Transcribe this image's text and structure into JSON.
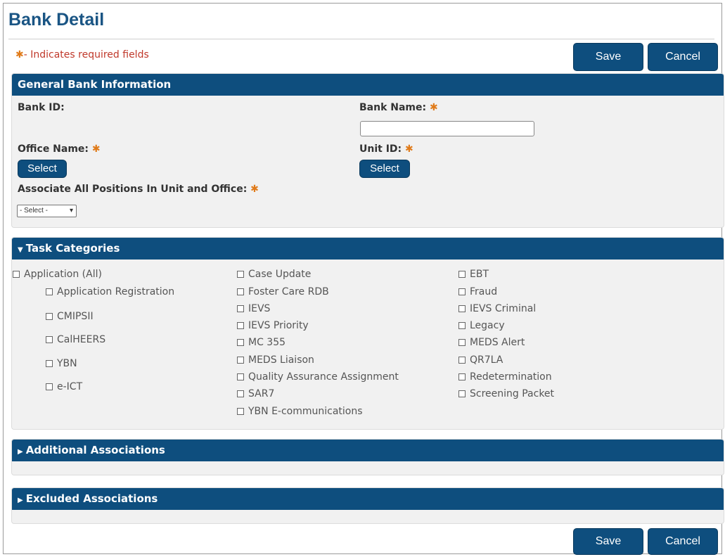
{
  "page": {
    "title": "Bank Detail"
  },
  "required_note": {
    "star": "✱",
    "text": "- Indicates required fields"
  },
  "buttons": {
    "save": "Save",
    "cancel": "Cancel"
  },
  "general": {
    "header": "General Bank Information",
    "bank_id_label": "Bank ID:",
    "bank_name_label": "Bank Name:",
    "bank_name_value": "",
    "office_name_label": "Office Name:",
    "unit_id_label": "Unit ID:",
    "select_label": "Select",
    "associate_label": "Associate All Positions In Unit and Office:",
    "associate_selected": "- Select -"
  },
  "tasks": {
    "header": "Task Categories",
    "col1_parent": "Application (All)",
    "col1": [
      "Application Registration",
      "CMIPSII",
      "CalHEERS",
      "YBN",
      "e-ICT"
    ],
    "col2": [
      "Case Update",
      "Foster Care RDB",
      "IEVS",
      "IEVS Priority",
      "MC 355",
      "MEDS Liaison",
      "Quality Assurance Assignment",
      "SAR7",
      "YBN E-communications"
    ],
    "col3": [
      "EBT",
      "Fraud",
      "IEVS Criminal",
      "Legacy",
      "MEDS Alert",
      "QR7LA",
      "Redetermination",
      "Screening Packet"
    ]
  },
  "additional": {
    "header": "Additional Associations"
  },
  "excluded": {
    "header": "Excluded Associations"
  },
  "colors": {
    "header_bg": "#0e4e7e",
    "title": "#1a5584",
    "required_star": "#e07b1a",
    "required_text": "#c0392b"
  },
  "icons": {
    "required": "asterisk-icon",
    "expand": "triangle-right-icon",
    "collapse": "triangle-down-icon",
    "dropdown": "chevron-down-icon"
  }
}
